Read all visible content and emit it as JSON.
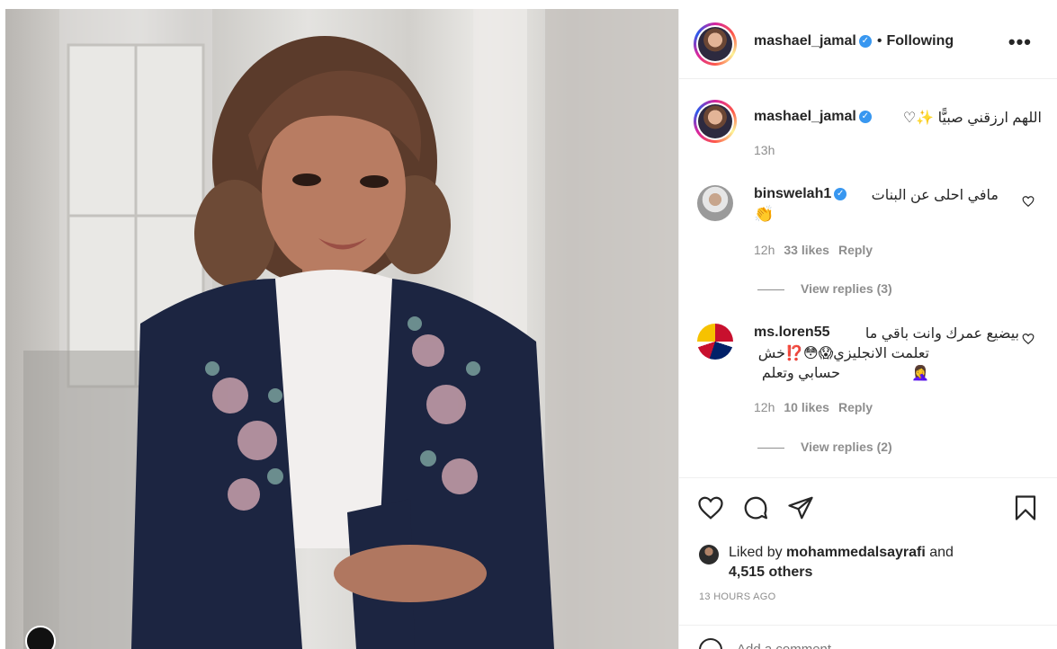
{
  "post": {
    "author": {
      "username": "mashael_jamal",
      "verified": true,
      "follow_status": "Following"
    },
    "caption": {
      "username": "mashael_jamal",
      "text": "اللهم ارزقني صبيًّا ✨♡",
      "time": "13h"
    },
    "comments": [
      {
        "username": "binswelah1",
        "verified": true,
        "text": "مافي احلى عن البنات",
        "emoji": "👏",
        "time": "12h",
        "likes": "33 likes",
        "reply_label": "Reply",
        "view_replies": "View replies (3)"
      },
      {
        "username": "ms.loren55",
        "verified": false,
        "text_line1": "بيضيع عمرك وانت باقي ما",
        "text_line2": "تعلمت الانجليزي😱😳⁉️خش🤦‍♀️",
        "text_line3": "حسابي وتعلم",
        "time": "12h",
        "likes": "10 likes",
        "reply_label": "Reply",
        "view_replies": "View replies (2)"
      }
    ],
    "liked_by": {
      "prefix": "Liked by",
      "user": "mohammedalsayrafi",
      "joiner": "and",
      "others": "4,515 others"
    },
    "time_ago": "13 HOURS AGO",
    "add_comment_placeholder": "Add a comment..."
  },
  "icons": {
    "more": "more-options-icon",
    "heart": "heart-icon",
    "comment": "comment-icon",
    "share": "share-icon",
    "save": "bookmark-icon",
    "verified": "verified-badge-icon",
    "emoji": "emoji-icon"
  },
  "colors": {
    "verified": "#3897f0",
    "secondary_text": "#8e8e8e",
    "primary_text": "#262626",
    "abaya_navy": "#1c2541"
  }
}
